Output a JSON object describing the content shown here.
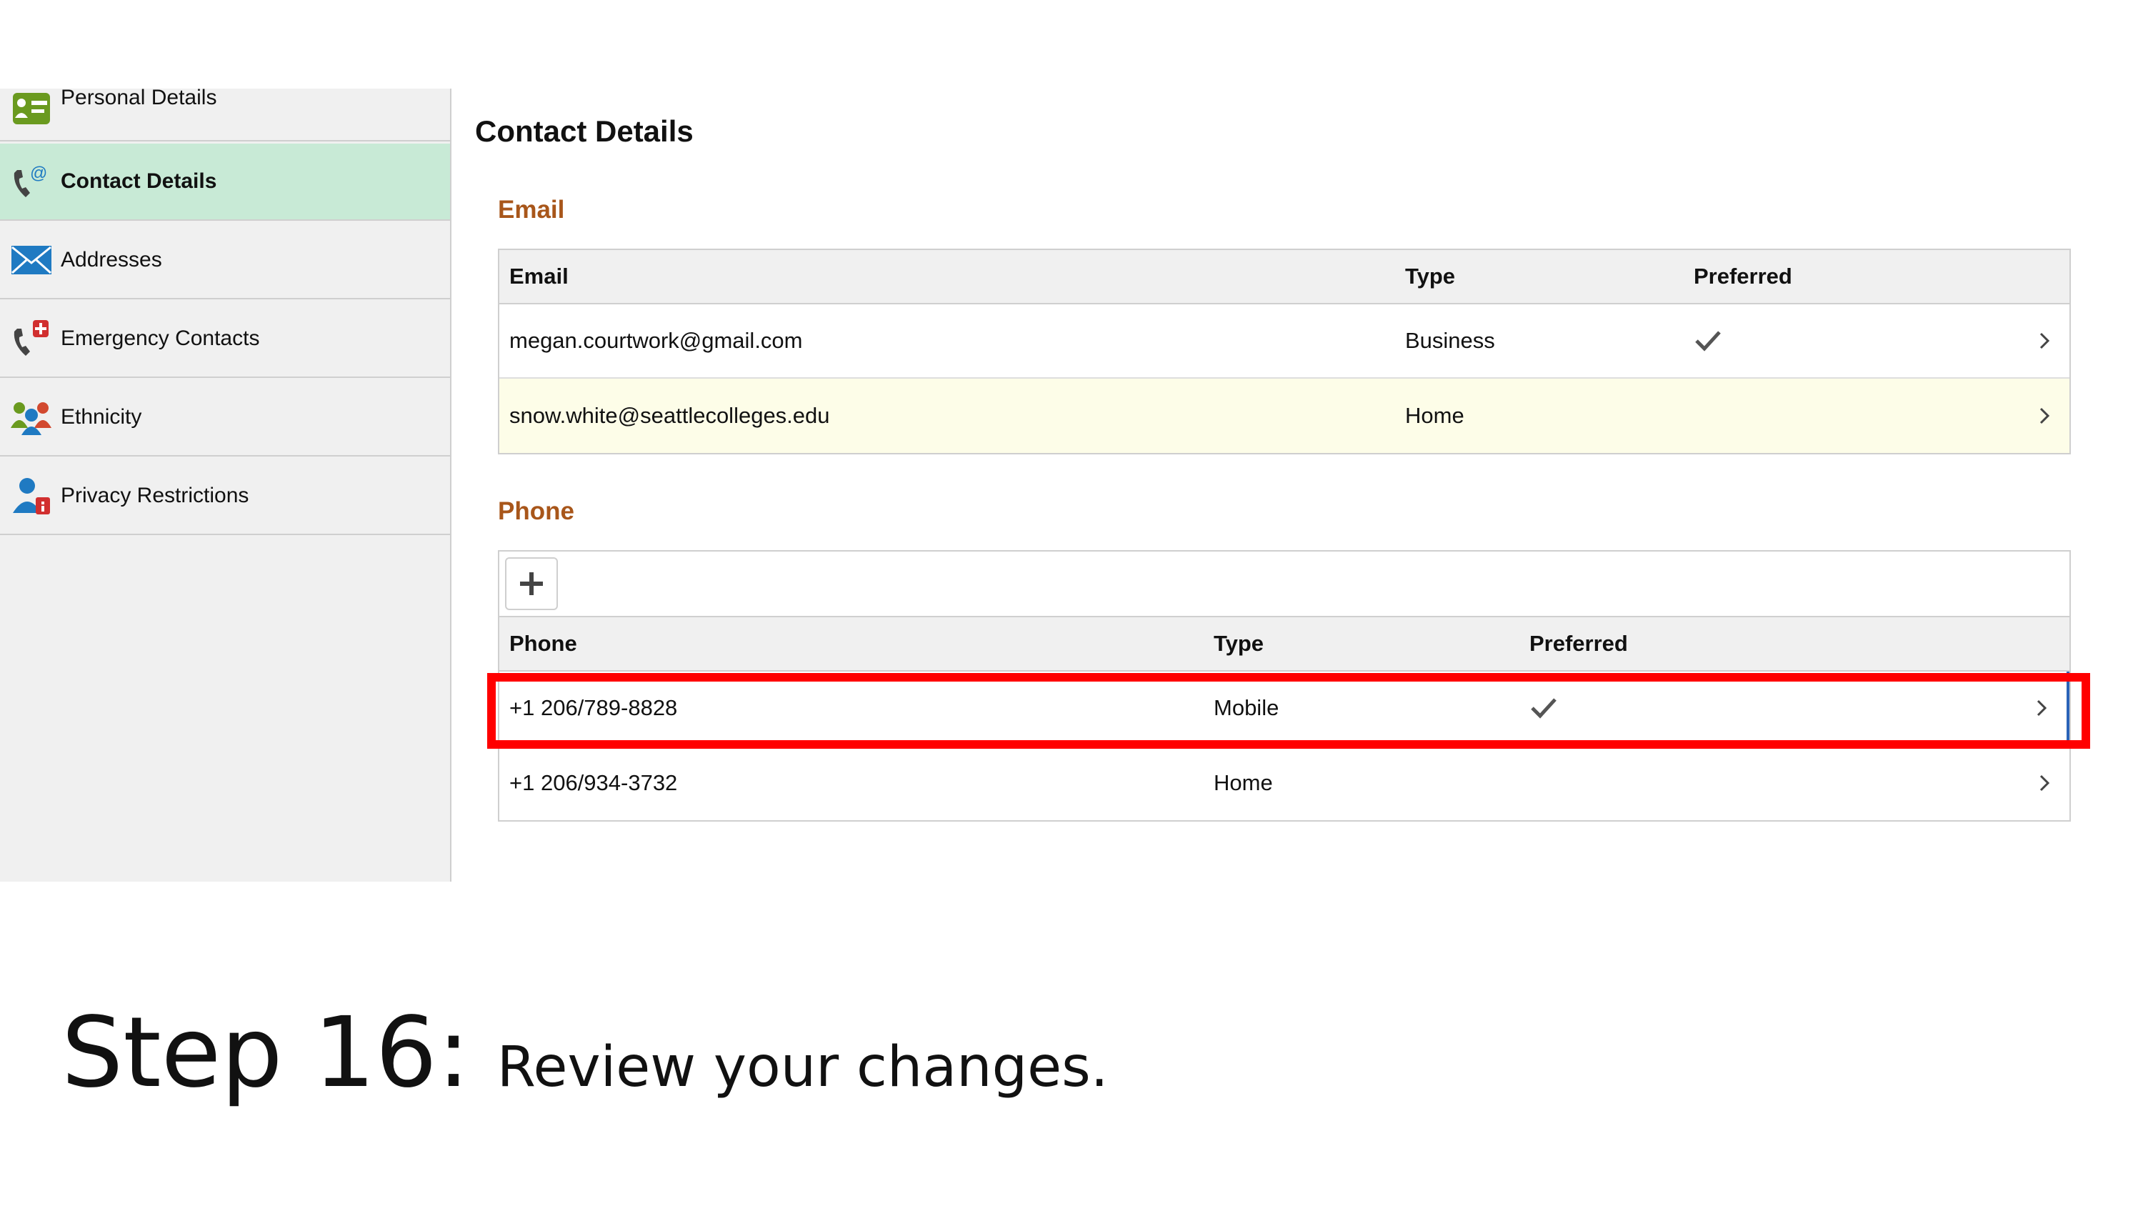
{
  "sidebar": {
    "items": [
      {
        "label": "Personal Details",
        "icon": "id-card-icon",
        "active": false
      },
      {
        "label": "Contact Details",
        "icon": "phone-at-icon",
        "active": true
      },
      {
        "label": "Addresses",
        "icon": "envelope-icon",
        "active": false
      },
      {
        "label": "Emergency Contacts",
        "icon": "phone-plus-icon",
        "active": false
      },
      {
        "label": "Ethnicity",
        "icon": "people-icon",
        "active": false
      },
      {
        "label": "Privacy Restrictions",
        "icon": "person-lock-icon",
        "active": false
      }
    ]
  },
  "main": {
    "title": "Contact Details",
    "email": {
      "section_title": "Email",
      "columns": [
        "Email",
        "Type",
        "Preferred"
      ],
      "rows": [
        {
          "email": "megan.courtwork@gmail.com",
          "type": "Business",
          "preferred": true
        },
        {
          "email": "snow.white@seattlecolleges.edu",
          "type": "Home",
          "preferred": false
        }
      ]
    },
    "phone": {
      "section_title": "Phone",
      "add_label": "+",
      "columns": [
        "Phone",
        "Type",
        "Preferred"
      ],
      "rows": [
        {
          "phone": "+1 206/789-8828",
          "type": "Mobile",
          "preferred": true
        },
        {
          "phone": "+1 206/934-3732",
          "type": "Home",
          "preferred": false
        }
      ]
    }
  },
  "caption": {
    "step": "Step 16:",
    "description": "Review your changes."
  },
  "colors": {
    "section_title": "#a8561a",
    "active_bg": "#c8ead6",
    "highlight_row_bg": "#fdfde8",
    "highlight_box": "#ff0000"
  }
}
